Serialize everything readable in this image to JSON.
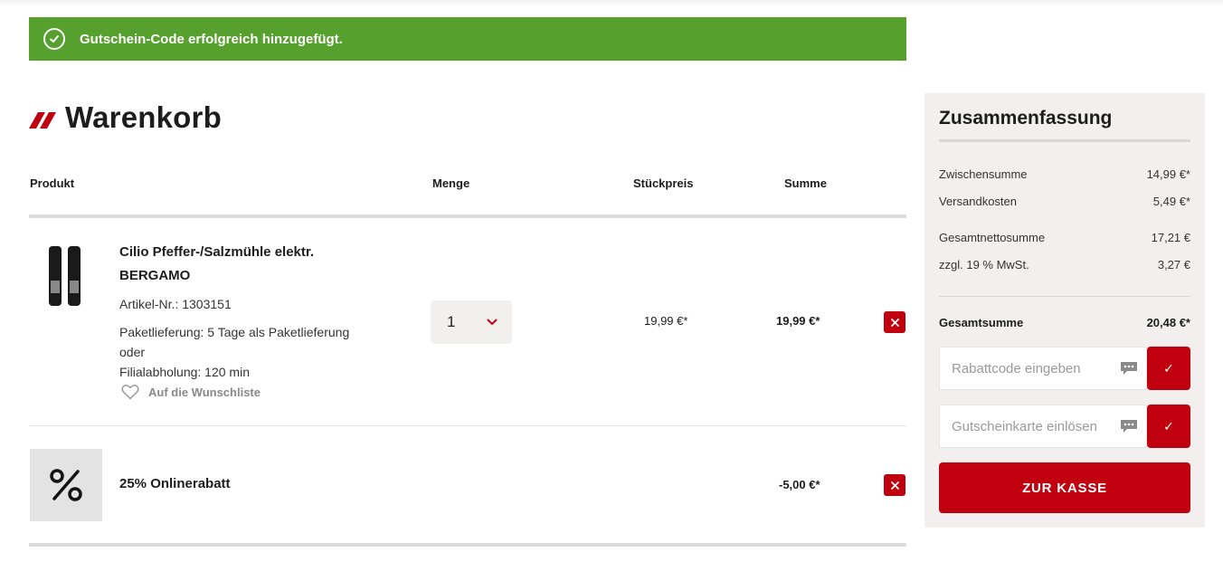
{
  "banner": {
    "message": "Gutschein-Code erfolgreich hinzugefügt.",
    "color": "#56a02d"
  },
  "cart": {
    "title": "Warenkorb",
    "columns": {
      "product": "Produkt",
      "quantity": "Menge",
      "unit_price": "Stückpreis",
      "sum": "Summe"
    },
    "item": {
      "name": "Cilio Pfeffer-/Salzmühle elektr. BERGAMO",
      "article": "Artikel-Nr.: 1303151",
      "delivery": "Paketlieferung: 5 Tage als Paketlieferung oder",
      "pickup": "Filialabholung: 120 min",
      "wishlist": "Auf die Wunschliste",
      "quantity": "1",
      "unit_price": "19,99 €*",
      "sum": "19,99 €*"
    },
    "discount": {
      "label": "25% Onlinerabatt",
      "sum": "-5,00 €*"
    }
  },
  "summary": {
    "title": "Zusammenfassung",
    "rows": [
      {
        "label": "Zwischensumme",
        "value": "14,99 €*"
      },
      {
        "label": "Versandkosten",
        "value": "5,49 €*"
      },
      {
        "label": "Gesamtnettosumme",
        "value": "17,21 €"
      },
      {
        "label": "zzgl. 19 % MwSt.",
        "value": "3,27 €"
      }
    ],
    "total": {
      "label": "Gesamtsumme",
      "value": "20,48 €*"
    },
    "coupon_placeholder": "Rabattcode eingeben",
    "giftcard_placeholder": "Gutscheinkarte einlösen",
    "apply_label": "✓",
    "checkout_label": "ZUR KASSE"
  },
  "colors": {
    "accent": "#c0000f",
    "summary_bg": "#f2efee",
    "success": "#56a02d"
  }
}
